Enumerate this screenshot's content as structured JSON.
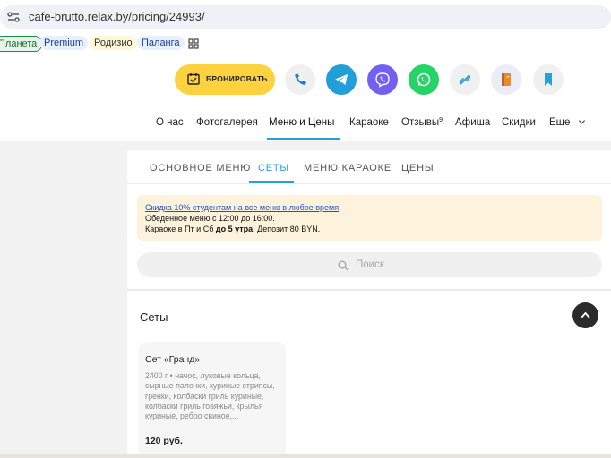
{
  "browser": {
    "url": "cafe-brutto.relax.by/pricing/24993/",
    "bookmarks": [
      "Планета",
      "Premium",
      "Родизио",
      "Паланга"
    ]
  },
  "header": {
    "book_label": "БРОНИРОВАТЬ",
    "icons": [
      "phone-icon",
      "telegram-icon",
      "viber-icon",
      "whatsapp-icon",
      "link-icon",
      "menu-book-icon",
      "bookmark-icon"
    ],
    "colors": {
      "yellow": "#fdd23f",
      "telegram": "#229ed9",
      "viber": "#7360f2",
      "whatsapp": "#25d366",
      "accent": "#2a9fd6"
    }
  },
  "nav": {
    "items": [
      "О нас",
      "Фотогалерея",
      "Меню и Цены",
      "Караоке",
      "Отзывы",
      "Афиша",
      "Скидки",
      "Еще"
    ],
    "reviews_count": "9",
    "active": "Меню и Цены"
  },
  "tabs": {
    "items": [
      "ОСНОВНОЕ МЕНЮ",
      "СЕТЫ",
      "МЕНЮ КАРАОКЕ",
      "ЦЕНЫ"
    ],
    "active": "СЕТЫ"
  },
  "notice": {
    "link": "Скидка 10% студентам на все меню в любое время",
    "line2": "Обеденное меню с 12:00 до 16:00.",
    "line3_a": "Караоке в Пт и Сб ",
    "line3_bold": "до 5 утра",
    "line3_b": "! Депозит 80 BYN."
  },
  "search": {
    "placeholder": "Поиск"
  },
  "section": {
    "title": "Сеты"
  },
  "set_card": {
    "name": "Сет «Гранд»",
    "description": "2400 г • начос, луковые кольца, сырные палочки, куриные стрипсы, гренки, колбаски гриль куриные, колбаски гриль говяжьи, крылья куриные, ребро свиное,...",
    "price": "120 руб."
  }
}
